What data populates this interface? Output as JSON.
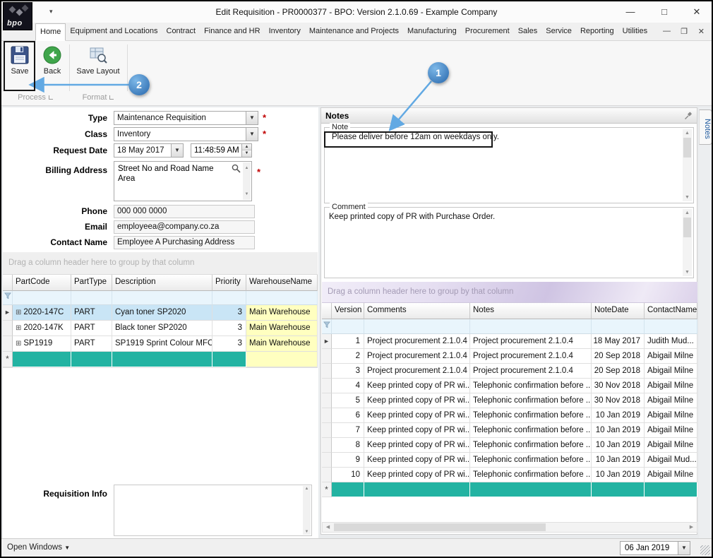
{
  "window": {
    "title": "Edit Requisition - PR0000377 - BPO: Version 2.1.0.69 - Example Company",
    "logo_text": "bpo"
  },
  "menu": {
    "tabs": [
      "Home",
      "Equipment and Locations",
      "Contract",
      "Finance and HR",
      "Inventory",
      "Maintenance and Projects",
      "Manufacturing",
      "Procurement",
      "Sales",
      "Service",
      "Reporting",
      "Utilities"
    ],
    "active_tab": "Home"
  },
  "ribbon": {
    "save": "Save",
    "back": "Back",
    "save_layout": "Save Layout",
    "group_process": "Process",
    "group_format": "Format"
  },
  "callouts": {
    "step1": "1",
    "step2": "2"
  },
  "form": {
    "type_label": "Type",
    "type_value": "Maintenance Requisition",
    "class_label": "Class",
    "class_value": "Inventory",
    "request_date_label": "Request Date",
    "request_date_value": "18 May 2017",
    "request_time_value": "11:48:59 AM",
    "billing_address_label": "Billing Address",
    "billing_address_line1": "Street No and Road Name",
    "billing_address_line2": "Area",
    "phone_label": "Phone",
    "phone_value": "000 000 0000",
    "email_label": "Email",
    "email_value": "employeea@company.co.za",
    "contact_label": "Contact Name",
    "contact_value": "Employee A Purchasing Address",
    "required_marker": "*",
    "requisition_info_label": "Requisition Info"
  },
  "parts_grid": {
    "group_hint": "Drag a column header here to group by that column",
    "columns": [
      "PartCode",
      "PartType",
      "Description",
      "Priority",
      "WarehouseName"
    ],
    "rows": [
      {
        "PartCode": "2020-147C",
        "PartType": "PART",
        "Description": "Cyan toner SP2020",
        "Priority": "3",
        "WarehouseName": "Main Warehouse"
      },
      {
        "PartCode": "2020-147K",
        "PartType": "PART",
        "Description": "Black toner SP2020",
        "Priority": "3",
        "WarehouseName": "Main Warehouse"
      },
      {
        "PartCode": "SP1919",
        "PartType": "PART",
        "Description": "SP1919 Sprint Colour MFC",
        "Priority": "3",
        "WarehouseName": "Main Warehouse"
      }
    ]
  },
  "notes_panel": {
    "title": "Notes",
    "side_tab": "Notes",
    "note_legend": "Note",
    "note_text": "Please deliver before 12am on weekdays only.",
    "comment_legend": "Comment",
    "comment_text": "Keep printed copy of PR with Purchase Order.",
    "grid": {
      "group_hint": "Drag a column header here to group by that column",
      "columns": [
        "Version",
        "Comments",
        "Notes",
        "NoteDate",
        "ContactName"
      ],
      "rows": [
        {
          "Version": "1",
          "Comments": "Project procurement 2.1.0.4",
          "Notes": "Project procurement 2.1.0.4",
          "NoteDate": "18 May 2017",
          "ContactName": "Judith Mud..."
        },
        {
          "Version": "2",
          "Comments": "Project procurement 2.1.0.4",
          "Notes": "Project procurement 2.1.0.4",
          "NoteDate": "20 Sep 2018",
          "ContactName": "Abigail Milne"
        },
        {
          "Version": "3",
          "Comments": "Project procurement 2.1.0.4",
          "Notes": "Project procurement 2.1.0.4",
          "NoteDate": "20 Sep 2018",
          "ContactName": "Abigail Milne"
        },
        {
          "Version": "4",
          "Comments": "Keep printed copy of PR wi...",
          "Notes": "Telephonic confirmation before ...",
          "NoteDate": "30 Nov 2018",
          "ContactName": "Abigail Milne"
        },
        {
          "Version": "5",
          "Comments": "Keep printed copy of PR wi...",
          "Notes": "Telephonic confirmation before ...",
          "NoteDate": "30 Nov 2018",
          "ContactName": "Abigail Milne"
        },
        {
          "Version": "6",
          "Comments": "Keep printed copy of PR wi...",
          "Notes": "Telephonic confirmation before ...",
          "NoteDate": "10 Jan 2019",
          "ContactName": "Abigail Milne"
        },
        {
          "Version": "7",
          "Comments": "Keep printed copy of PR wi...",
          "Notes": "Telephonic confirmation before ...",
          "NoteDate": "10 Jan 2019",
          "ContactName": "Abigail Milne"
        },
        {
          "Version": "8",
          "Comments": "Keep printed copy of PR wi...",
          "Notes": "Telephonic confirmation before ...",
          "NoteDate": "10 Jan 2019",
          "ContactName": "Abigail Milne"
        },
        {
          "Version": "9",
          "Comments": "Keep printed copy of PR wi...",
          "Notes": "Telephonic confirmation before ...",
          "NoteDate": "10 Jan 2019",
          "ContactName": "Abigail Mud..."
        },
        {
          "Version": "10",
          "Comments": "Keep printed copy of PR wi...",
          "Notes": "Telephonic confirmation before ...",
          "NoteDate": "10 Jan 2019",
          "ContactName": "Abigail Milne"
        }
      ]
    }
  },
  "status_bar": {
    "open_windows": "Open Windows",
    "date": "06 Jan 2019"
  },
  "colors": {
    "accent_teal": "#23b3a2",
    "highlight_yellow": "#ffffc0",
    "selection_blue": "#c9e5f6",
    "callout_blue": "#2766ab",
    "arrow_blue": "#62a9e3",
    "required_red": "#c00000"
  }
}
